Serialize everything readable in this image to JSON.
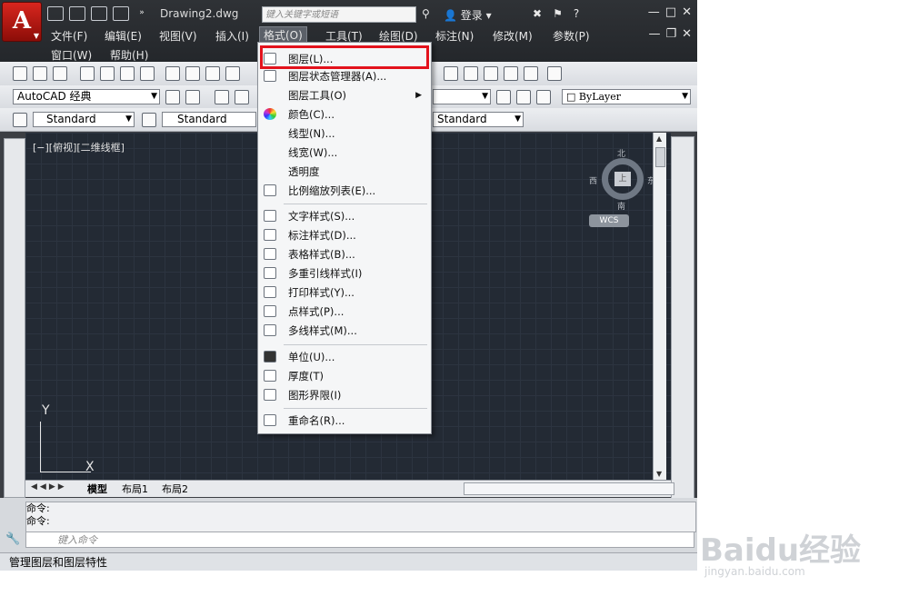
{
  "window": {
    "title": "Drawing2.dwg",
    "logo_letter": "A",
    "search_placeholder": "键入关键字或短语",
    "login_label": "登录",
    "controls": [
      "—",
      "□",
      "✕"
    ]
  },
  "menubar": {
    "row1": [
      "文件(F)",
      "编辑(E)",
      "视图(V)",
      "插入(I)",
      "格式(O)",
      "工具(T)",
      "绘图(D)",
      "标注(N)",
      "修改(M)",
      "参数(P)"
    ],
    "row2": [
      "窗口(W)",
      "帮助(H)"
    ],
    "active": "格式(O)"
  },
  "toolbars": {
    "workspace": "AutoCAD 经典",
    "text_style": "Standard",
    "dim_style": "Standard",
    "table_style": "Standard",
    "layer": "ByLayer"
  },
  "viewport": {
    "label": "[−][俯视][二维线框]",
    "compass": {
      "north": "北",
      "south": "南",
      "east": "东",
      "west": "西",
      "top": "上",
      "wcs": "WCS"
    },
    "ucs_y": "Y",
    "ucs_x": "X"
  },
  "layout_tabs": [
    "模型",
    "布局1",
    "布局2"
  ],
  "format_menu": {
    "items": [
      {
        "label": "图层(L)...",
        "icon": "layers-icon"
      },
      {
        "label": "图层状态管理器(A)...",
        "icon": "layer-state-icon"
      },
      {
        "label": "图层工具(O)",
        "icon": "",
        "submenu": true
      },
      {
        "label": "颜色(C)...",
        "icon": "color-wheel-icon"
      },
      {
        "label": "线型(N)...",
        "icon": ""
      },
      {
        "label": "线宽(W)...",
        "icon": ""
      },
      {
        "label": "透明度",
        "icon": ""
      },
      {
        "label": "比例缩放列表(E)...",
        "icon": "scale-list-icon"
      },
      {
        "label": "文字样式(S)...",
        "icon": "text-style-icon"
      },
      {
        "label": "标注样式(D)...",
        "icon": "dim-style-icon"
      },
      {
        "label": "表格样式(B)...",
        "icon": "table-style-icon"
      },
      {
        "label": "多重引线样式(I)",
        "icon": "mleader-style-icon"
      },
      {
        "label": "打印样式(Y)...",
        "icon": "plot-style-icon"
      },
      {
        "label": "点样式(P)...",
        "icon": "point-style-icon"
      },
      {
        "label": "多线样式(M)...",
        "icon": "mline-style-icon"
      },
      {
        "label": "单位(U)...",
        "icon": "units-icon"
      },
      {
        "label": "厚度(T)",
        "icon": "thickness-icon"
      },
      {
        "label": "图形界限(I)",
        "icon": "limits-icon"
      },
      {
        "label": "重命名(R)...",
        "icon": "rename-icon"
      }
    ],
    "highlighted": "图层(L)..."
  },
  "command": {
    "history": [
      "命令:",
      "命令:"
    ],
    "placeholder": "键入命令"
  },
  "status_bar": "管理图层和图层特性",
  "watermark": {
    "brand": "Baidu经验",
    "url": "jingyan.baidu.com"
  }
}
